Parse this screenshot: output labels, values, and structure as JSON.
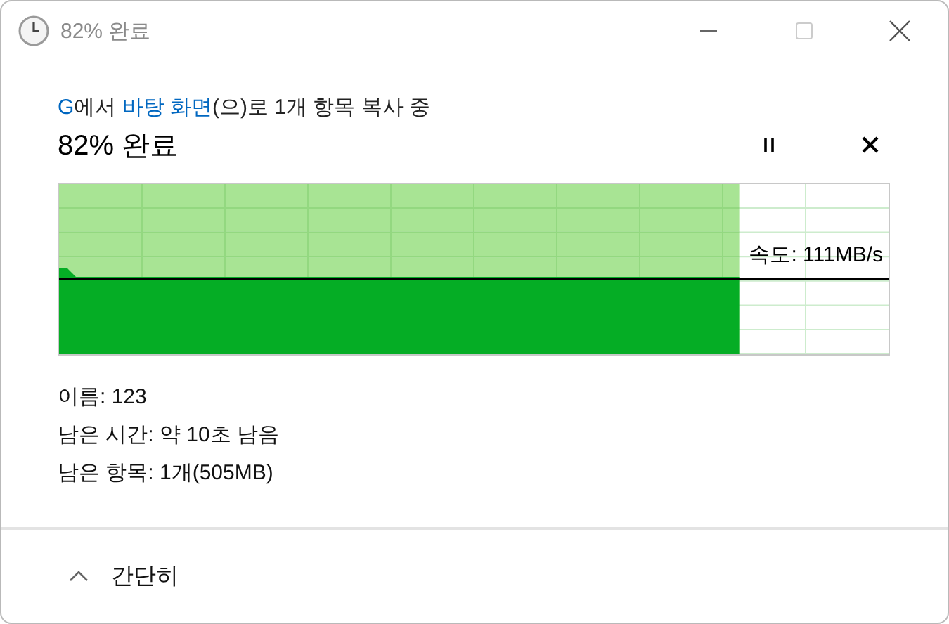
{
  "window": {
    "title": "82% 완료"
  },
  "description": [
    {
      "text": "G",
      "kind": "link"
    },
    {
      "text": "에서 ",
      "kind": "plain"
    },
    {
      "text": "바탕 화면",
      "kind": "link"
    },
    {
      "text": "(으)로 1개 항목 복사 중",
      "kind": "plain"
    }
  ],
  "progress": {
    "heading": "82% 완료",
    "level": 0.82,
    "speed": "속도: 111MB/s"
  },
  "details": [
    "이름: 123",
    "남은 시간: 약 10초 남음",
    "남은 항목: 1개(505MB)"
  ],
  "footer": {
    "toggle": "간단히"
  }
}
